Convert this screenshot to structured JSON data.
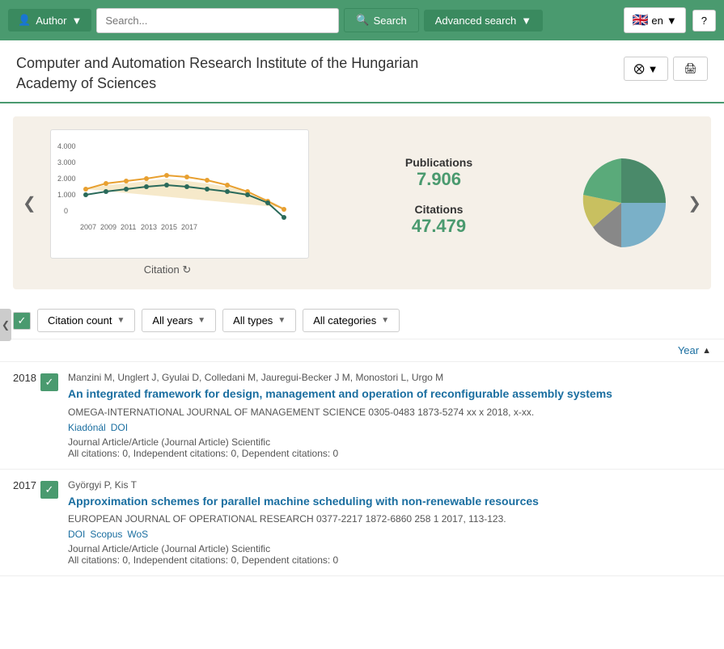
{
  "header": {
    "author_btn": "Author",
    "search_placeholder": "Search...",
    "search_btn": "Search",
    "advanced_btn": "Advanced search",
    "lang": "en",
    "help_btn": "?"
  },
  "institute": {
    "title_line1": "Computer and Automation Research Institute of the Hungarian",
    "title_line2": "Academy of Sciences"
  },
  "chart": {
    "label": "Citation",
    "nav_left": "❮",
    "nav_right": "❯",
    "publications_label": "Publications",
    "publications_value": "7.906",
    "citations_label": "Citations",
    "citations_value": "47.479"
  },
  "filters": {
    "citation_count": "Citation count",
    "all_years": "All years",
    "all_types": "All types",
    "all_categories": "All categories"
  },
  "sort": {
    "label": "Year",
    "arrow": "▲"
  },
  "results": [
    {
      "year": "2018",
      "authors": "Manzini M, Unglert J, Gyulai D, Colledani M, Jauregui-Becker J M, Monostori L, Urgo M",
      "title": "An integrated framework for design, management and operation of reconfigurable assembly systems",
      "journal": "OMEGA-INTERNATIONAL JOURNAL OF MANAGEMENT SCIENCE 0305-0483 1873-5274 xx x 2018, x-xx.",
      "links": [
        {
          "text": "Kiadónál",
          "href": "#"
        },
        {
          "text": "DOI",
          "href": "#"
        }
      ],
      "type": "Journal Article/Article (Journal Article) Scientific",
      "citations": "All citations: 0, Independent citations: 0, Dependent citations: 0"
    },
    {
      "year": "2017",
      "authors": "Györgyi P, Kis T",
      "title": "Approximation schemes for parallel machine scheduling with non-renewable resources",
      "journal": "EUROPEAN JOURNAL OF OPERATIONAL RESEARCH 0377-2217 1872-6860 258 1 2017, 113-123.",
      "links": [
        {
          "text": "DOI",
          "href": "#"
        },
        {
          "text": "Scopus",
          "href": "#"
        },
        {
          "text": "WoS",
          "href": "#"
        }
      ],
      "type": "Journal Article/Article (Journal Article) Scientific",
      "citations": "All citations: 0, Independent citations: 0, Dependent citations: 0"
    }
  ]
}
